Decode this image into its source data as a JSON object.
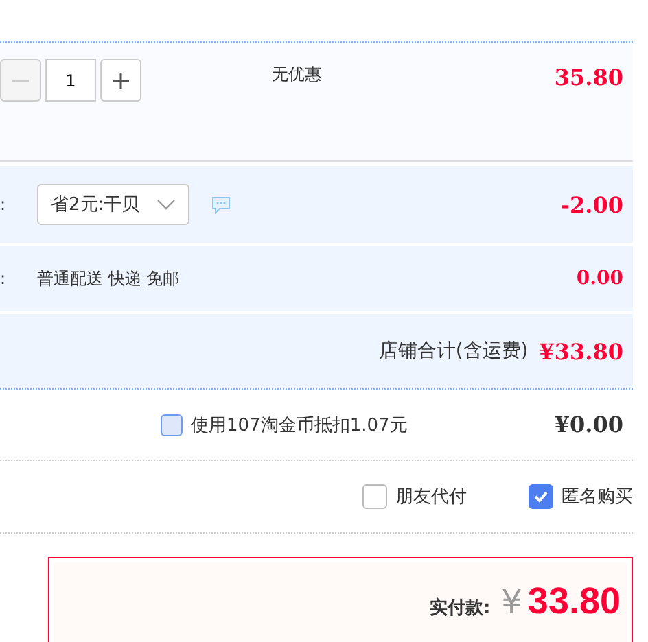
{
  "item": {
    "quantity": "1",
    "promotion": "无优惠",
    "price": "35.80",
    "minus_disabled": true
  },
  "discount": {
    "label_tail": ":",
    "selected_option": "省2元:干贝",
    "amount": "-2.00"
  },
  "shipping": {
    "label_tail": ":",
    "method": "普通配送 快递 免邮",
    "amount": "0.00"
  },
  "store_total": {
    "label": "店铺合计(含运费)",
    "amount": "¥33.80"
  },
  "coins": {
    "checked": false,
    "label": "使用107淘金币抵扣1.07元",
    "amount": "¥0.00"
  },
  "options": [
    {
      "label": "朋友代付",
      "checked": false
    },
    {
      "label": "匿名购买",
      "checked": true
    }
  ],
  "payment": {
    "label": "实付款:",
    "currency": "¥",
    "amount": "33.80"
  }
}
